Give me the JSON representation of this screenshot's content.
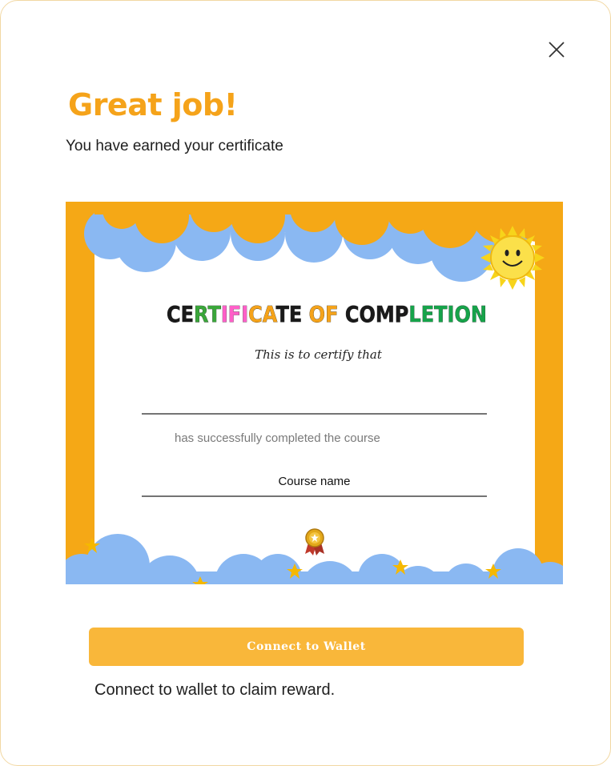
{
  "dialog": {
    "title": "Great job!",
    "subtitle": "You have earned your certificate",
    "close_icon": "close-icon",
    "accent_color": "#f5a31a"
  },
  "certificate": {
    "heading_parts": [
      {
        "text": "CE",
        "color": "#1a1a1a"
      },
      {
        "text": "RT",
        "color": "#3aa63a"
      },
      {
        "text": "IFI",
        "color": "#ff5fc8"
      },
      {
        "text": "CA",
        "color": "#f5a31a"
      },
      {
        "text": "TE",
        "color": "#1a1a1a"
      },
      {
        "text": " OF ",
        "color": "#f5a31a"
      },
      {
        "text": "COMP",
        "color": "#1a1a1a"
      },
      {
        "text": "LETION",
        "color": "#16a34a"
      }
    ],
    "certify_text": "This is to certify that",
    "completed_text": "has successfully completed the course",
    "course_name": "Course name",
    "frame_color": "#f5a816",
    "cloud_color": "#8ab8f2"
  },
  "actions": {
    "connect_button": "Connect to Wallet",
    "note": "Connect to wallet to claim reward."
  }
}
